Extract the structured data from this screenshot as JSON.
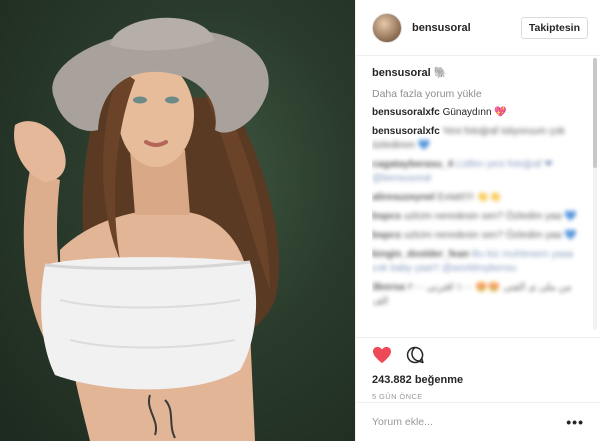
{
  "post": {
    "username": "bensusoral",
    "follow_label": "Takiptesin",
    "caption_user": "bensusoral",
    "caption_emoji": "🐘",
    "load_more": "Daha fazla yorum yükle",
    "comments": [
      {
        "user": "bensusoralxfc",
        "text": "Günaydınn 💖",
        "blurred": false
      },
      {
        "user": "bensusoralxfc",
        "text": "Yeni fotoğraf istiyoruum çok özledimm 💙",
        "blurred": false,
        "text_blurred": true
      },
      {
        "user": "cagatayberasu_4",
        "text": "Lütfen yeni fotoğraf ❤ @bensusoral",
        "blurred": true
      },
      {
        "user": "aliresuzeynel",
        "text": "Evlatt!!!! 👏👏",
        "blurred": true
      },
      {
        "user": "bspcs",
        "text": "uzlcim neredesin sen? Özledim yaa 💙",
        "blurred": true
      },
      {
        "user": "bspcs",
        "text": "uzlcim neredesin sen? Özledim yaa 💙",
        "blurred": true
      },
      {
        "user": "kingin_doslder_fean",
        "text": "Bu kiz muhtesem yaaa cok baby yaa!!! @worldmybensu",
        "blurred": true
      },
      {
        "user": "3borsa",
        "text": "من ملی ی الفتی 😍😍 ۱۰۰ افترنی ۲۰۰ الف",
        "blurred": true
      }
    ],
    "likes": "243.882 beğenme",
    "time": "5 GÜN ÖNCE",
    "comment_placeholder": "Yorum ekle...",
    "more_label": "•••"
  },
  "icons": {
    "like": "heart-icon",
    "comment": "comment-icon"
  },
  "colors": {
    "heart": "#ed4956",
    "link_blue": "#5b79a7"
  }
}
